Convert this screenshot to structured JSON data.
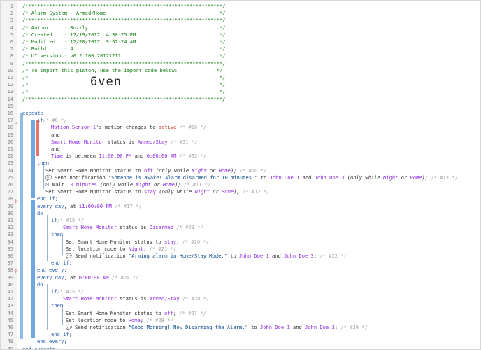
{
  "line_numbers": [
    "1",
    "2",
    "3",
    "4",
    "5",
    "6",
    "7",
    "8",
    "9",
    "10",
    "11",
    "12",
    "13",
    "14",
    "15",
    "16",
    "17",
    "18",
    "19",
    "20",
    "21",
    "22",
    "23",
    "24",
    "25",
    "26",
    "27",
    "28",
    "29",
    "30",
    "31",
    "32",
    "33",
    "34",
    "35",
    "36",
    "37",
    "38",
    "39",
    "40",
    "41",
    "42",
    "43",
    "44",
    "45",
    "46",
    "47",
    "48",
    "49"
  ],
  "header": {
    "l1": "/******************************************************************/",
    "l2": "/* Alarm System - Armed/Home                                      */",
    "l3": "/******************************************************************/",
    "l4": "/* Author     : Rozzly                                            */",
    "l5": "/* Created    : 12/19/2017, 4:30:25 PM                            */",
    "l6": "/* Modified   : 12/20/2017, 9:52:24 AM                            */",
    "l7": "/* Build      : 4                                                 */",
    "l8": "/* UI version : v0.2.100.20171211                                 */",
    "l9": "/******************************************************************/",
    "l10": "/* To import this piston, use the import code below:             */",
    "l11": "/*                                                                */",
    "l12": "/*                                                                */",
    "l13": "/*                                                                */",
    "l14": "/******************************************************************/",
    "import_code": "6ven"
  },
  "code": {
    "execute": "execute",
    "if": "if",
    "then": "then",
    "and": "and",
    "do": "do",
    "end_if": "end if;",
    "end_every": "end every;",
    "end_execute": "end execute;",
    "c8": "/* #8 */",
    "l18_dev": "Motion Sensor 1",
    "l18_mid": "'s motion changes to ",
    "l18_val": "active",
    "l18_cm": " /* #16 */",
    "l20_dev": "Smart Home Monitor",
    "l20_mid": " status is ",
    "l20_val": "Armed/Stay",
    "l20_cm": " /* #31 */",
    "l22_dev": "Time",
    "l22_mid": " is between ",
    "l22_v1": "11:00:00 PM",
    "l22_and": " and ",
    "l22_v2": "6:00:00 AM",
    "l22_cm": " /* #32 */",
    "l24_a": "Set Smart Home Monitor status to ",
    "l24_v": "off",
    "l24_b": " (only while ",
    "l24_n": "Night",
    "l24_or": " or ",
    "l24_h": "Home",
    "l24_c": ");",
    "l24_cm": " /* #10 */",
    "l25_icon": "💬",
    "l25_a": " Send notification ",
    "l25_s": "\"Someone is awake! Alarm disarmed for 10 minutes.\"",
    "l25_to": " to ",
    "l25_p1": "John Doe 1",
    "l25_and": " and ",
    "l25_p2": "John Doe 3",
    "l25_b": " (only while ",
    "l25_n": "Night",
    "l25_or": " or ",
    "l25_h": "Home",
    "l25_c": ");",
    "l25_cm": " /* #13 */",
    "l26_icon": "⏲",
    "l26_a": " Wait ",
    "l26_v": "10 minutes",
    "l26_b": " (only while ",
    "l26_n": "Night",
    "l26_or": " or ",
    "l26_h": "Home",
    "l26_c": ");",
    "l26_cm": " /* #11 */",
    "l27_a": "Set Smart Home Monitor status to ",
    "l27_v": "stay",
    "l27_b": " (only while ",
    "l27_n": "Night",
    "l27_or": " or ",
    "l27_h": "Home",
    "l27_c": ");",
    "l27_cm": " /* #12 */",
    "l29_a": "every day",
    "l29_b": ", at ",
    "l29_v": "11:00:00 PM",
    "l29_cm": " /* #17 */",
    "c18": "/* #18 */",
    "l32_dev": "Smart Home Monitor",
    "l32_mid": " status is ",
    "l32_val": "Disarmed",
    "l32_cm": " /* #23 */",
    "l34_a": "Set Smart Home Monitor status to ",
    "l34_v": "stay",
    "l34_c": ";",
    "l34_cm": " /* #20 */",
    "l35_a": "Set location mode to ",
    "l35_v": "Night",
    "l35_c": ";",
    "l35_cm": " /* #21 */",
    "l36_icon": "💬",
    "l36_a": " Send notification ",
    "l36_s": "\"Arming alarm in Home/Stay Mode.\"",
    "l36_to": " to ",
    "l36_p1": "John Doe 1",
    "l36_and": " and ",
    "l36_p2": "John Doe 3",
    "l36_c": ";",
    "l36_cm": " /* #22 */",
    "l39_a": "every day",
    "l39_b": ", at ",
    "l39_v": "6:00:00 AM",
    "l39_cm": " /* #24 */",
    "c25": "/* #25 */",
    "l42_dev": "Smart Home Monitor",
    "l42_mid": " status is ",
    "l42_val": "Armed/Stay",
    "l42_cm": " /* #30 */",
    "l44_a": "Set Smart Home Monitor status to ",
    "l44_v": "off",
    "l44_c": ";",
    "l44_cm": " /* #27 */",
    "l45_a": "Set location mode to ",
    "l45_v": "Home",
    "l45_c": ";",
    "l45_cm": " /* #28 */",
    "l46_icon": "💬",
    "l46_a": " Send notification ",
    "l46_s": "\"Good Morning! Now Disarming the Alarm.\"",
    "l46_to": " to ",
    "l46_p1": "John Doe 1",
    "l46_and": " and ",
    "l46_p2": "John Doe 3",
    "l46_c": ";",
    "l46_cm": " /* #29 */"
  },
  "colors": {
    "comment_green": "#1a7d1a",
    "keyword_blue": "#2a5db0",
    "value_purple": "#8a2be2",
    "string_blue": "#0a4a8a",
    "condition_bar": "#e8736b",
    "block_bar": "#6fa7e0"
  }
}
